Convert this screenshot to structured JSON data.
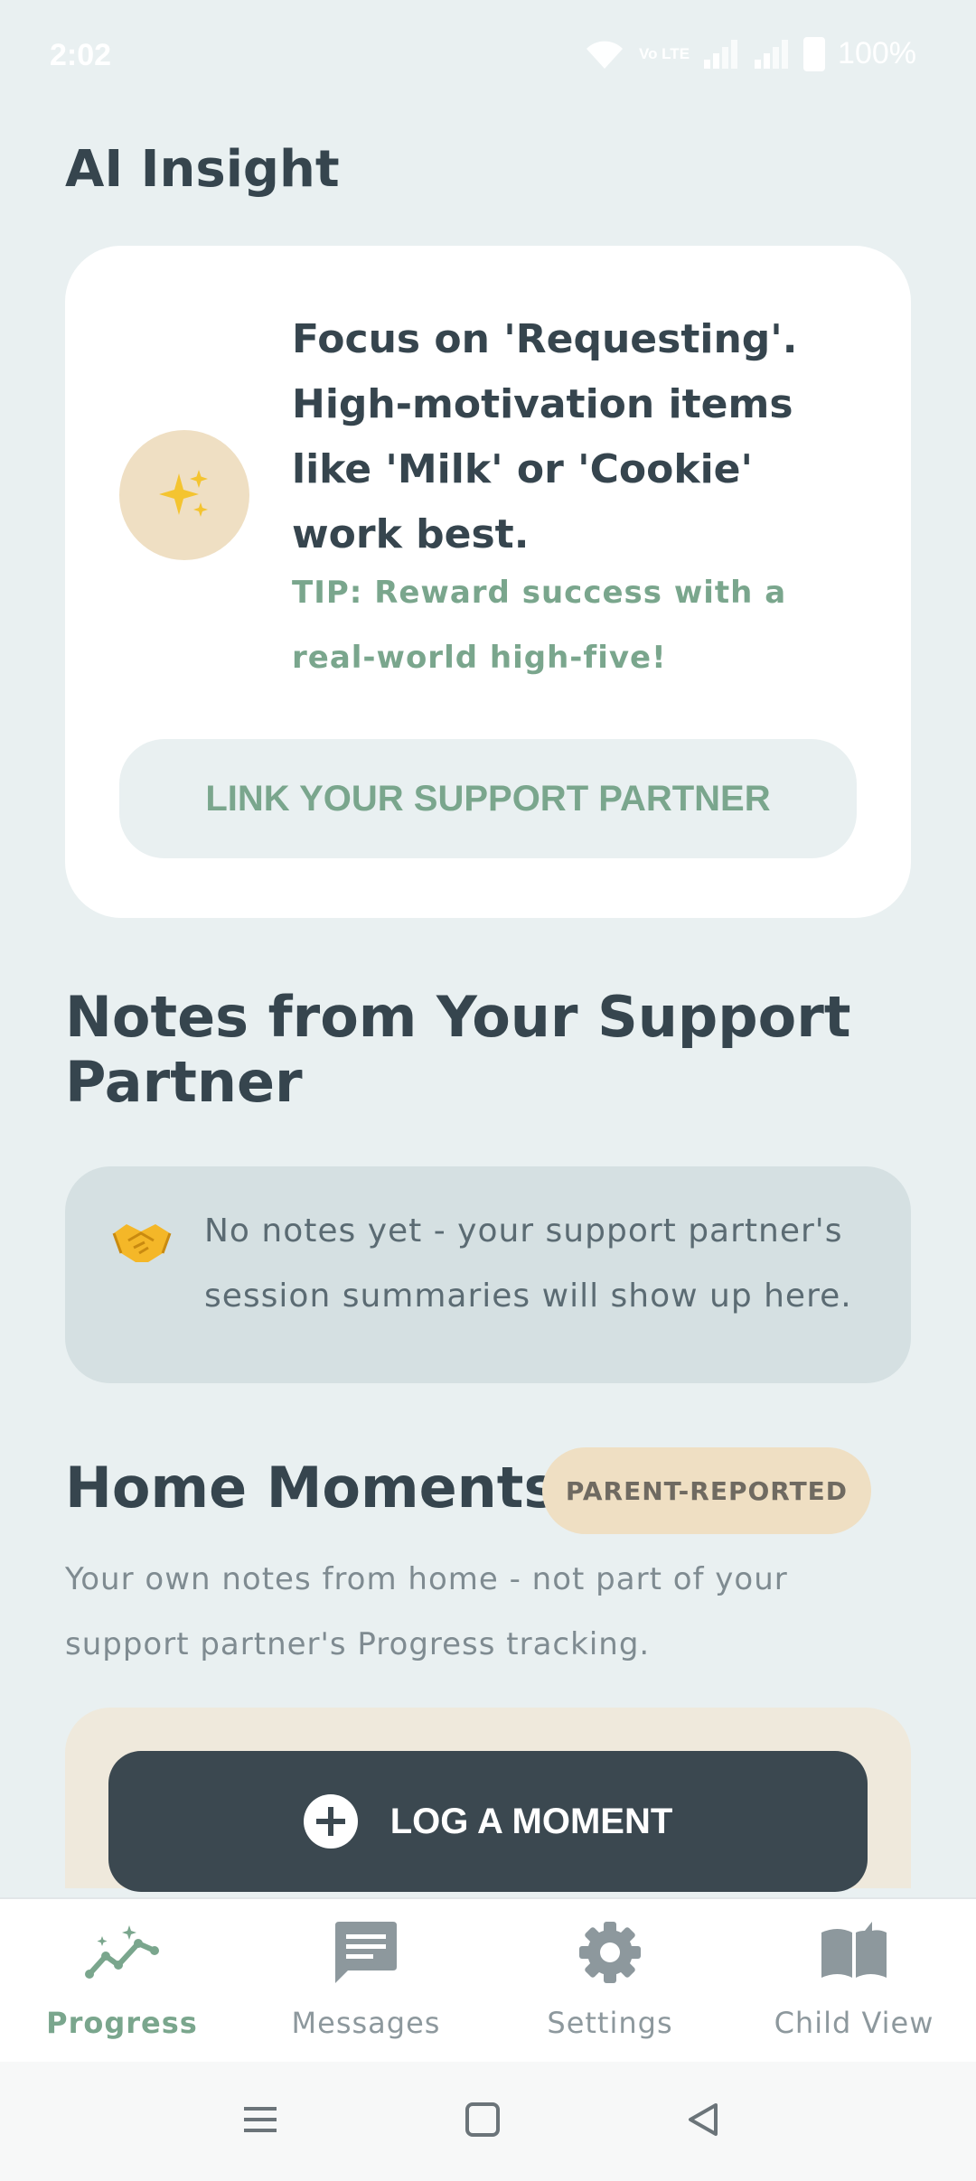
{
  "status_bar": {
    "time": "2:02",
    "volte": "Vo LTE",
    "battery": "100%"
  },
  "ai_insight": {
    "title": "AI Insight",
    "icon": "sparkles-icon",
    "message": "Focus on 'Requesting'. High-motivation items like 'Milk' or 'Cookie' work best.",
    "tip": "TIP: Reward success with a real-world high-five!",
    "link_button": "LINK YOUR SUPPORT PARTNER"
  },
  "notes": {
    "title": "Notes from Your Support Partner",
    "icon": "handshake-icon",
    "empty_text": "No notes yet - your support partner's session summaries will show up here."
  },
  "home_moments": {
    "title": "Home Moments",
    "badge": "PARENT-REPORTED",
    "subtitle": "Your own notes from home - not part of your support partner's Progress tracking.",
    "log_button": "LOG A MOMENT"
  },
  "bottom_nav": {
    "items": [
      {
        "label": "Progress",
        "icon": "progress-chart-icon",
        "active": true
      },
      {
        "label": "Messages",
        "icon": "message-icon",
        "active": false
      },
      {
        "label": "Settings",
        "icon": "gear-icon",
        "active": false
      },
      {
        "label": "Child View",
        "icon": "book-icon",
        "active": false
      }
    ]
  },
  "colors": {
    "background": "#e9f0f1",
    "accent_green": "#7aa68d",
    "dark_text": "#36454e",
    "badge_bg": "#efdfc3",
    "dark_button": "#3b4850"
  }
}
